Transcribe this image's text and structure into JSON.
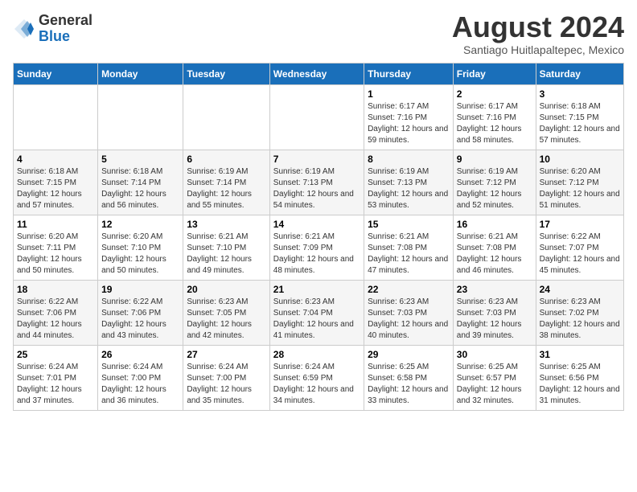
{
  "logo": {
    "general": "General",
    "blue": "Blue"
  },
  "title": {
    "month_year": "August 2024",
    "location": "Santiago Huitlapaltepec, Mexico"
  },
  "days_of_week": [
    "Sunday",
    "Monday",
    "Tuesday",
    "Wednesday",
    "Thursday",
    "Friday",
    "Saturday"
  ],
  "weeks": [
    [
      {
        "day": "",
        "sunrise": "",
        "sunset": "",
        "daylight": ""
      },
      {
        "day": "",
        "sunrise": "",
        "sunset": "",
        "daylight": ""
      },
      {
        "day": "",
        "sunrise": "",
        "sunset": "",
        "daylight": ""
      },
      {
        "day": "",
        "sunrise": "",
        "sunset": "",
        "daylight": ""
      },
      {
        "day": "1",
        "sunrise": "Sunrise: 6:17 AM",
        "sunset": "Sunset: 7:16 PM",
        "daylight": "Daylight: 12 hours and 59 minutes."
      },
      {
        "day": "2",
        "sunrise": "Sunrise: 6:17 AM",
        "sunset": "Sunset: 7:16 PM",
        "daylight": "Daylight: 12 hours and 58 minutes."
      },
      {
        "day": "3",
        "sunrise": "Sunrise: 6:18 AM",
        "sunset": "Sunset: 7:15 PM",
        "daylight": "Daylight: 12 hours and 57 minutes."
      }
    ],
    [
      {
        "day": "4",
        "sunrise": "Sunrise: 6:18 AM",
        "sunset": "Sunset: 7:15 PM",
        "daylight": "Daylight: 12 hours and 57 minutes."
      },
      {
        "day": "5",
        "sunrise": "Sunrise: 6:18 AM",
        "sunset": "Sunset: 7:14 PM",
        "daylight": "Daylight: 12 hours and 56 minutes."
      },
      {
        "day": "6",
        "sunrise": "Sunrise: 6:19 AM",
        "sunset": "Sunset: 7:14 PM",
        "daylight": "Daylight: 12 hours and 55 minutes."
      },
      {
        "day": "7",
        "sunrise": "Sunrise: 6:19 AM",
        "sunset": "Sunset: 7:13 PM",
        "daylight": "Daylight: 12 hours and 54 minutes."
      },
      {
        "day": "8",
        "sunrise": "Sunrise: 6:19 AM",
        "sunset": "Sunset: 7:13 PM",
        "daylight": "Daylight: 12 hours and 53 minutes."
      },
      {
        "day": "9",
        "sunrise": "Sunrise: 6:19 AM",
        "sunset": "Sunset: 7:12 PM",
        "daylight": "Daylight: 12 hours and 52 minutes."
      },
      {
        "day": "10",
        "sunrise": "Sunrise: 6:20 AM",
        "sunset": "Sunset: 7:12 PM",
        "daylight": "Daylight: 12 hours and 51 minutes."
      }
    ],
    [
      {
        "day": "11",
        "sunrise": "Sunrise: 6:20 AM",
        "sunset": "Sunset: 7:11 PM",
        "daylight": "Daylight: 12 hours and 50 minutes."
      },
      {
        "day": "12",
        "sunrise": "Sunrise: 6:20 AM",
        "sunset": "Sunset: 7:10 PM",
        "daylight": "Daylight: 12 hours and 50 minutes."
      },
      {
        "day": "13",
        "sunrise": "Sunrise: 6:21 AM",
        "sunset": "Sunset: 7:10 PM",
        "daylight": "Daylight: 12 hours and 49 minutes."
      },
      {
        "day": "14",
        "sunrise": "Sunrise: 6:21 AM",
        "sunset": "Sunset: 7:09 PM",
        "daylight": "Daylight: 12 hours and 48 minutes."
      },
      {
        "day": "15",
        "sunrise": "Sunrise: 6:21 AM",
        "sunset": "Sunset: 7:08 PM",
        "daylight": "Daylight: 12 hours and 47 minutes."
      },
      {
        "day": "16",
        "sunrise": "Sunrise: 6:21 AM",
        "sunset": "Sunset: 7:08 PM",
        "daylight": "Daylight: 12 hours and 46 minutes."
      },
      {
        "day": "17",
        "sunrise": "Sunrise: 6:22 AM",
        "sunset": "Sunset: 7:07 PM",
        "daylight": "Daylight: 12 hours and 45 minutes."
      }
    ],
    [
      {
        "day": "18",
        "sunrise": "Sunrise: 6:22 AM",
        "sunset": "Sunset: 7:06 PM",
        "daylight": "Daylight: 12 hours and 44 minutes."
      },
      {
        "day": "19",
        "sunrise": "Sunrise: 6:22 AM",
        "sunset": "Sunset: 7:06 PM",
        "daylight": "Daylight: 12 hours and 43 minutes."
      },
      {
        "day": "20",
        "sunrise": "Sunrise: 6:23 AM",
        "sunset": "Sunset: 7:05 PM",
        "daylight": "Daylight: 12 hours and 42 minutes."
      },
      {
        "day": "21",
        "sunrise": "Sunrise: 6:23 AM",
        "sunset": "Sunset: 7:04 PM",
        "daylight": "Daylight: 12 hours and 41 minutes."
      },
      {
        "day": "22",
        "sunrise": "Sunrise: 6:23 AM",
        "sunset": "Sunset: 7:03 PM",
        "daylight": "Daylight: 12 hours and 40 minutes."
      },
      {
        "day": "23",
        "sunrise": "Sunrise: 6:23 AM",
        "sunset": "Sunset: 7:03 PM",
        "daylight": "Daylight: 12 hours and 39 minutes."
      },
      {
        "day": "24",
        "sunrise": "Sunrise: 6:23 AM",
        "sunset": "Sunset: 7:02 PM",
        "daylight": "Daylight: 12 hours and 38 minutes."
      }
    ],
    [
      {
        "day": "25",
        "sunrise": "Sunrise: 6:24 AM",
        "sunset": "Sunset: 7:01 PM",
        "daylight": "Daylight: 12 hours and 37 minutes."
      },
      {
        "day": "26",
        "sunrise": "Sunrise: 6:24 AM",
        "sunset": "Sunset: 7:00 PM",
        "daylight": "Daylight: 12 hours and 36 minutes."
      },
      {
        "day": "27",
        "sunrise": "Sunrise: 6:24 AM",
        "sunset": "Sunset: 7:00 PM",
        "daylight": "Daylight: 12 hours and 35 minutes."
      },
      {
        "day": "28",
        "sunrise": "Sunrise: 6:24 AM",
        "sunset": "Sunset: 6:59 PM",
        "daylight": "Daylight: 12 hours and 34 minutes."
      },
      {
        "day": "29",
        "sunrise": "Sunrise: 6:25 AM",
        "sunset": "Sunset: 6:58 PM",
        "daylight": "Daylight: 12 hours and 33 minutes."
      },
      {
        "day": "30",
        "sunrise": "Sunrise: 6:25 AM",
        "sunset": "Sunset: 6:57 PM",
        "daylight": "Daylight: 12 hours and 32 minutes."
      },
      {
        "day": "31",
        "sunrise": "Sunrise: 6:25 AM",
        "sunset": "Sunset: 6:56 PM",
        "daylight": "Daylight: 12 hours and 31 minutes."
      }
    ]
  ]
}
